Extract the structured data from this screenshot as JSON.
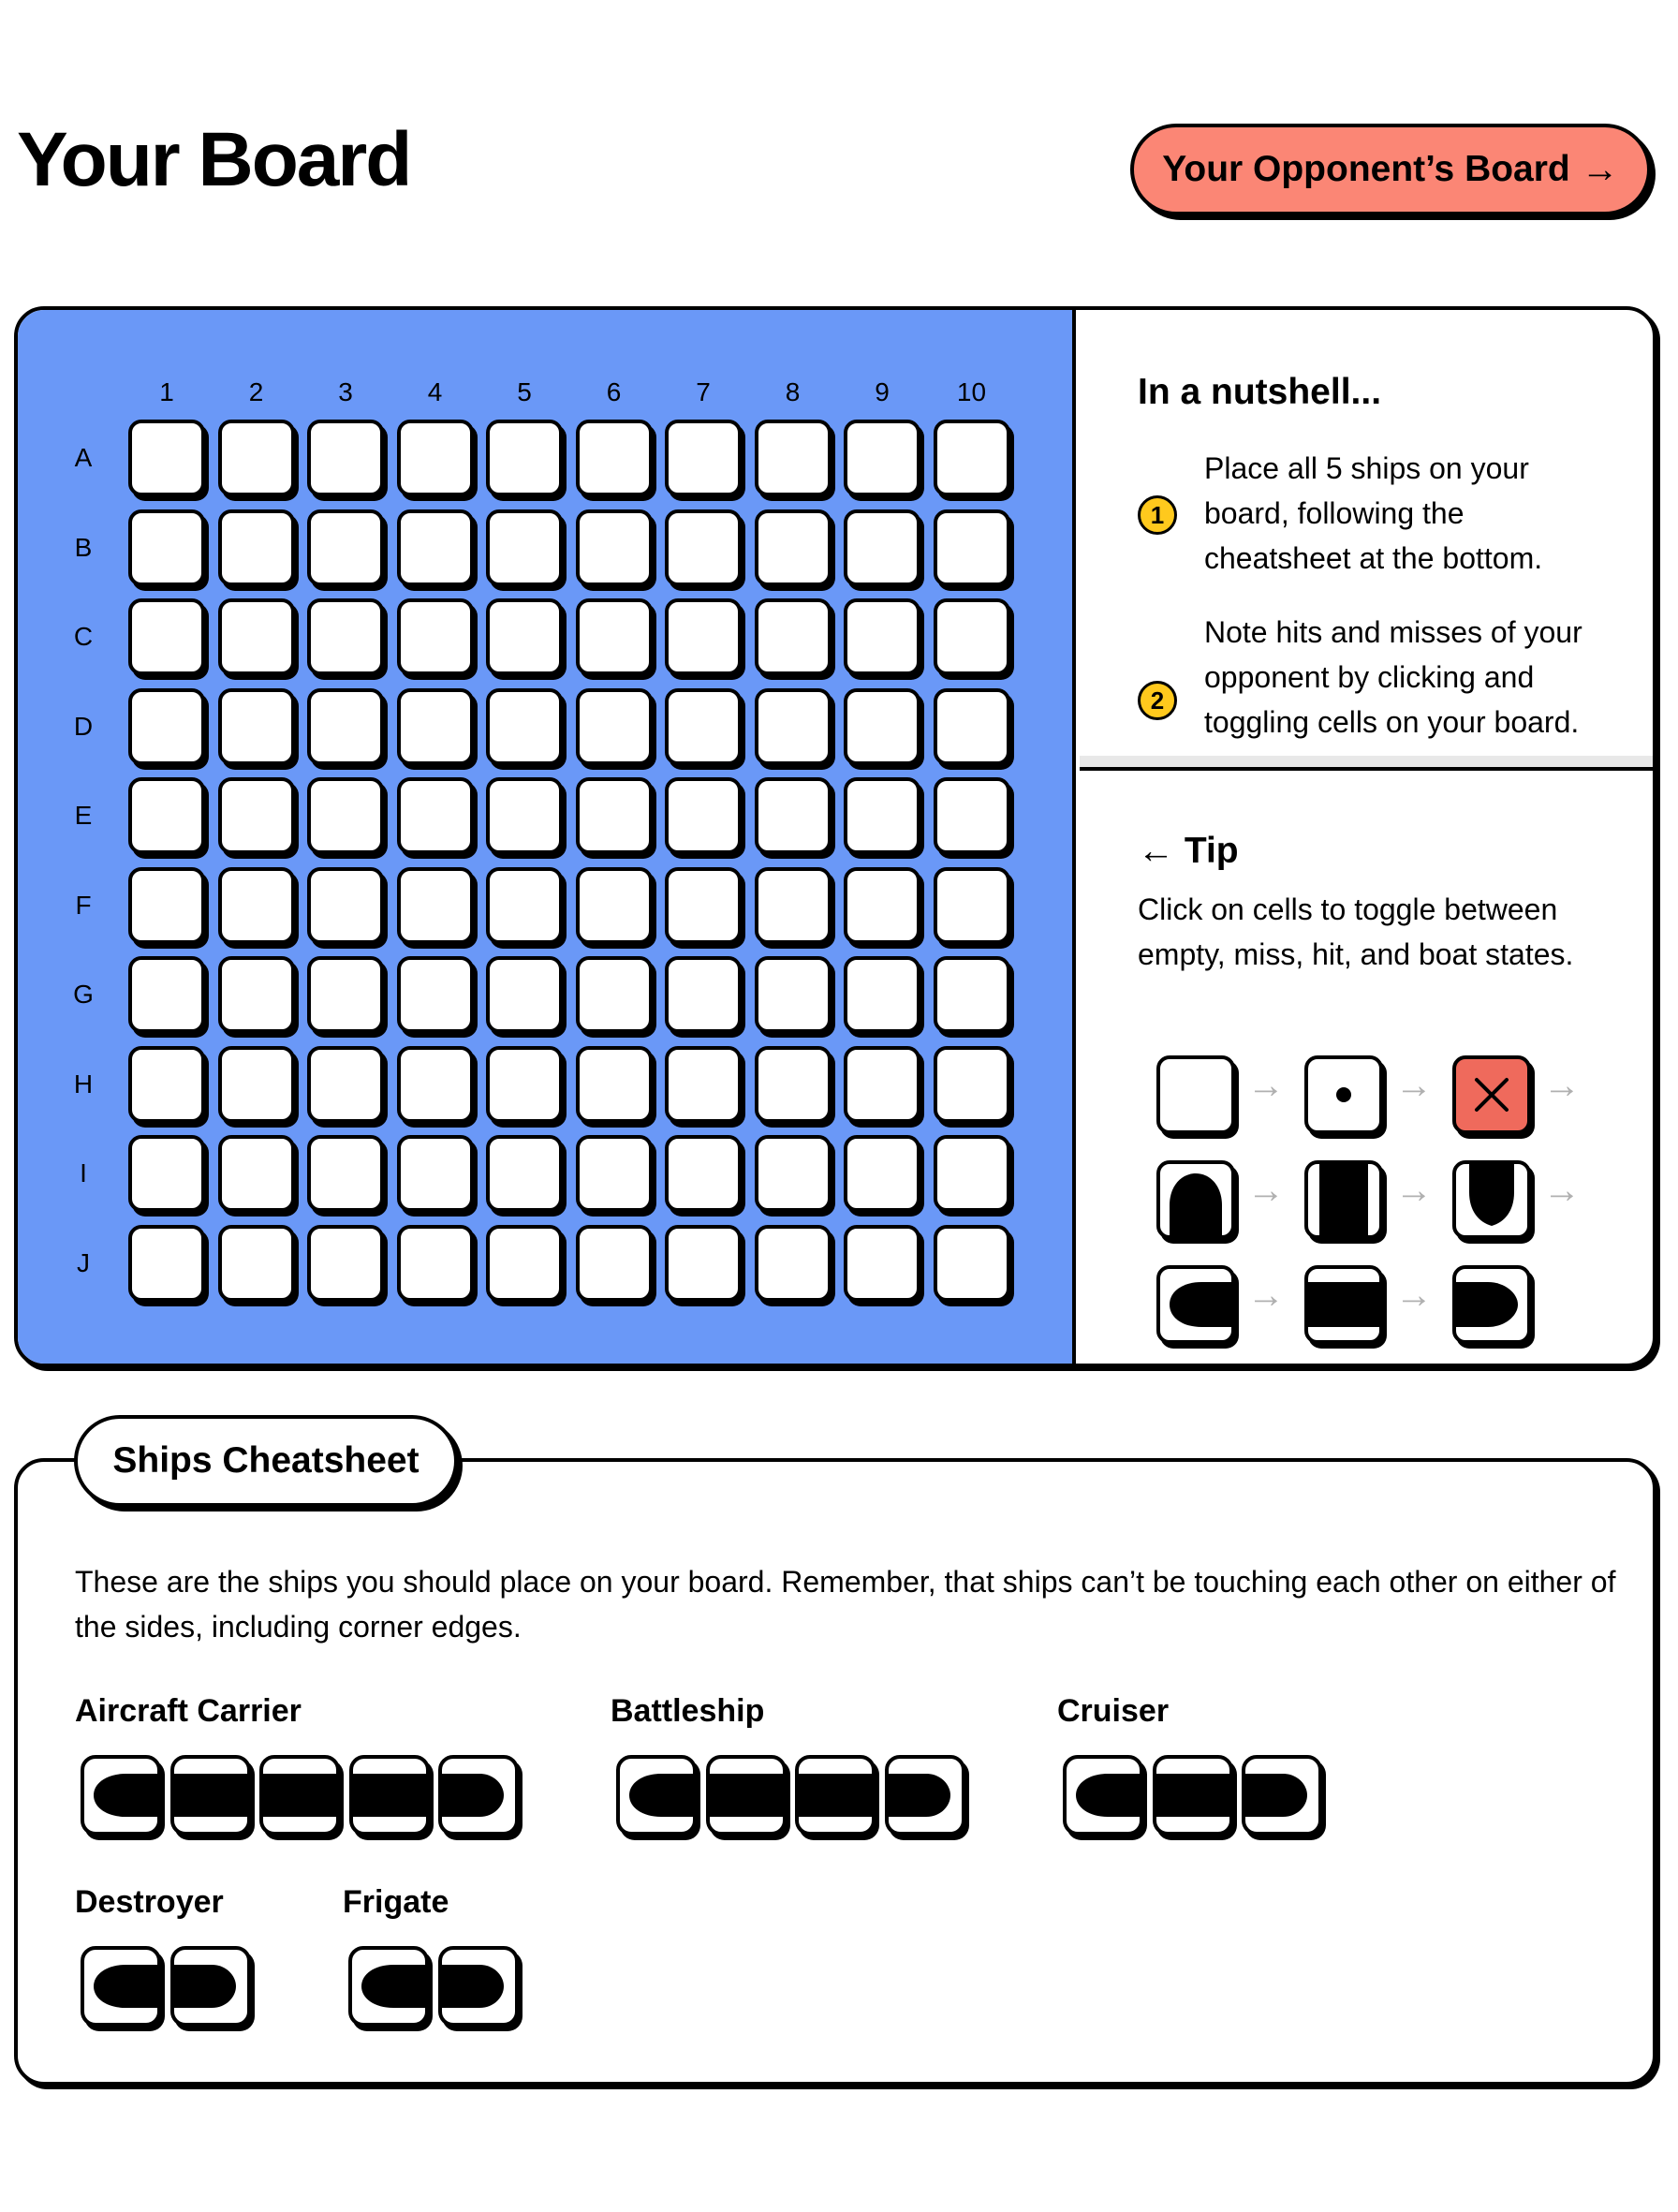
{
  "header": {
    "title": "Your Board",
    "opponent_button": "Your Opponent’s Board",
    "opponent_arrow": "→"
  },
  "board": {
    "columns": [
      "1",
      "2",
      "3",
      "4",
      "5",
      "6",
      "7",
      "8",
      "9",
      "10"
    ],
    "rows": [
      "A",
      "B",
      "C",
      "D",
      "E",
      "F",
      "G",
      "H",
      "I",
      "J"
    ],
    "cell_states": "empty",
    "background_color": "#6a98f7"
  },
  "instructions": {
    "title": "In a nutshell...",
    "steps": [
      {
        "number": "1",
        "text": "Place all 5 ships on your board, following the cheatsheet at the bottom."
      },
      {
        "number": "2",
        "text": "Note hits and misses of your opponent by clicking and toggling cells on your board."
      }
    ]
  },
  "tip": {
    "arrow": "←",
    "title": "Tip",
    "text": "Click on cells to toggle between empty, miss, hit, and boat states.",
    "cycle_arrow": "→",
    "hit_color": "#ef6a5c"
  },
  "cheatsheet": {
    "title": "Ships Cheatsheet",
    "description": "These are the ships you should place on your board. Remember, that ships can’t be touching each other on either of the sides, including corner edges.",
    "ships": [
      {
        "name": "Aircraft Carrier",
        "length": 5
      },
      {
        "name": "Battleship",
        "length": 4
      },
      {
        "name": "Cruiser",
        "length": 3
      },
      {
        "name": "Destroyer",
        "length": 2
      },
      {
        "name": "Frigate",
        "length": 2
      }
    ]
  },
  "colors": {
    "accent_button": "#fb8675",
    "step_badge": "#ffc91d"
  }
}
